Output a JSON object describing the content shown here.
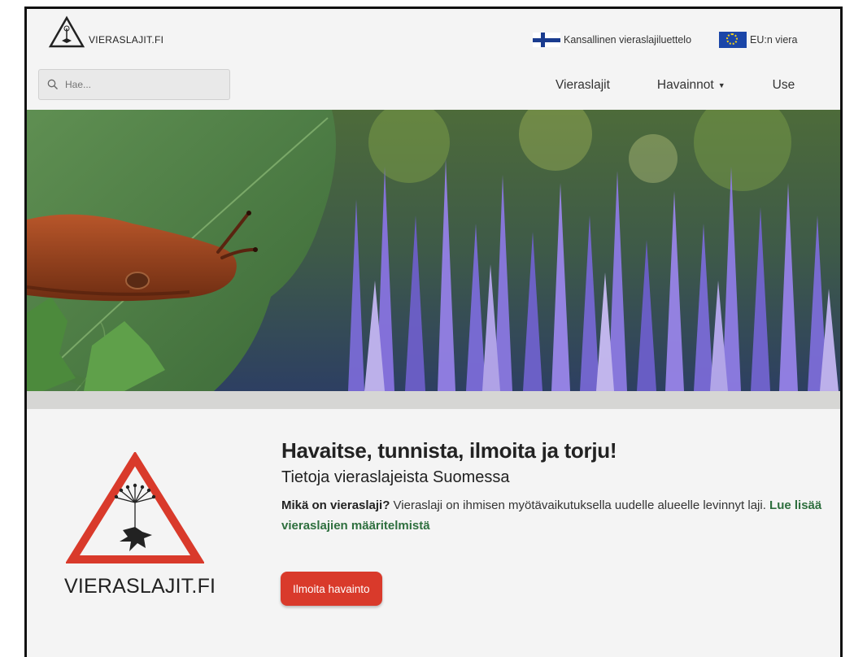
{
  "header": {
    "brand": "VIERASLAJIT.FI",
    "links": [
      {
        "label": "Kansallinen vieraslajiluettelo",
        "icon": "finland-flag-icon"
      },
      {
        "label": "EU:n viera",
        "icon": "eu-flag-icon"
      }
    ]
  },
  "search": {
    "placeholder": "Hae..."
  },
  "nav": [
    {
      "label": "Vieraslajit"
    },
    {
      "label": "Havainnot"
    },
    {
      "label": "Use"
    }
  ],
  "hero": {
    "image": "slug-on-leaf-and-lupine-flowers"
  },
  "intro": {
    "brand": "VIERASLAJIT.FI",
    "heading": "Havaitse, tunnista, ilmoita ja torju!",
    "subheading": "Tietoja vieraslajeista Suomessa",
    "lead_bold": "Mikä on vieraslaji?",
    "lead_text": " Vieraslaji on ihmisen myötävaikutuksella uudelle alueelle levinnyt laji. ",
    "lead_link": "Lue lisää vieraslajien määritelmistä",
    "button": "Ilmoita havainto"
  },
  "colors": {
    "accent_red": "#d93a2b",
    "link_green": "#2e6f3e",
    "background": "#f4f4f4"
  }
}
